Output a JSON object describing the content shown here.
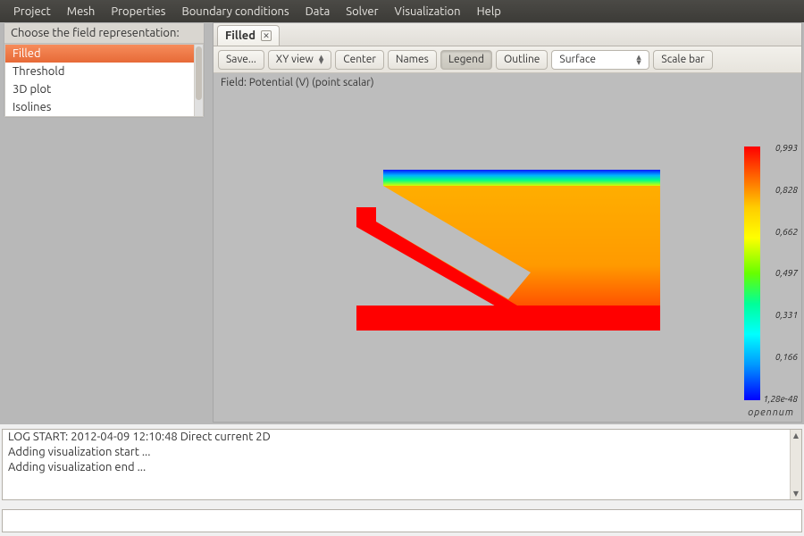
{
  "menu": [
    "Project",
    "Mesh",
    "Properties",
    "Boundary conditions",
    "Data",
    "Solver",
    "Visualization",
    "Help"
  ],
  "side": {
    "title": "Choose the field representation:",
    "items": [
      "Filled",
      "Threshold",
      "3D plot",
      "Isolines"
    ],
    "selected": 0
  },
  "tab": {
    "label": "Filled"
  },
  "toolbar": {
    "save": "Save...",
    "xyview": "XY view",
    "center": "Center",
    "names": "Names",
    "legend": "Legend",
    "outline": "Outline",
    "surface_selected": "Surface",
    "scalebar": "Scale bar"
  },
  "field_label": "Field:  Potential (V) (point scalar)",
  "brand": "opennum",
  "colorbar_ticks": [
    "0,993",
    "0,828",
    "0,662",
    "0,497",
    "0,331",
    "0,166",
    "1,28e-48"
  ],
  "log": [
    "LOG START: 2012-04-09 12:10:48 Direct current 2D",
    "Adding visualization start ...",
    "Adding visualization end ..."
  ],
  "chart_data": {
    "type": "heatmap",
    "title": "Potential (V) (point scalar)",
    "colormap": "rainbow",
    "value_range": [
      1.28e-48,
      0.993
    ],
    "colorbar_ticks": [
      0.993,
      0.828,
      0.662,
      0.497,
      0.331,
      0.166,
      1.28e-48
    ],
    "note": "2D filled contour of scalar potential field over a non-rectangular mesh domain; high potential (red) at lower boundary, low (blue) along top strip.",
    "legend": true,
    "outline": false
  }
}
